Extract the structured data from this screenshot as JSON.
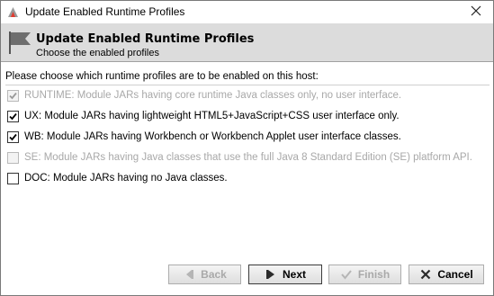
{
  "window": {
    "title": "Update Enabled Runtime Profiles"
  },
  "header": {
    "title": "Update Enabled Runtime Profiles",
    "subtitle": "Choose the enabled profiles"
  },
  "content": {
    "prompt": "Please choose which runtime profiles are to be enabled on this host:",
    "options": [
      {
        "label": "RUNTIME: Module JARs having core runtime Java classes only, no user interface.",
        "checked": true,
        "enabled": false
      },
      {
        "label": "UX: Module JARs having lightweight HTML5+JavaScript+CSS user interface only.",
        "checked": true,
        "enabled": true
      },
      {
        "label": "WB: Module JARs having Workbench or Workbench Applet user interface classes.",
        "checked": true,
        "enabled": true
      },
      {
        "label": "SE: Module JARs having Java classes that use the full Java 8 Standard Edition (SE) platform API.",
        "checked": false,
        "enabled": false
      },
      {
        "label": "DOC: Module JARs having no Java classes.",
        "checked": false,
        "enabled": true
      }
    ]
  },
  "buttons": {
    "back": "Back",
    "next": "Next",
    "finish": "Finish",
    "cancel": "Cancel"
  },
  "icons": {
    "app": "niagara-app-icon",
    "header": "flag-icon",
    "close": "close-icon",
    "back": "back-arrow-icon",
    "next": "next-arrow-icon",
    "finish": "checkmark-icon",
    "cancel": "x-icon"
  },
  "colors": {
    "header_band": "#dcdcdc",
    "disabled_text": "#a8a8a8"
  }
}
